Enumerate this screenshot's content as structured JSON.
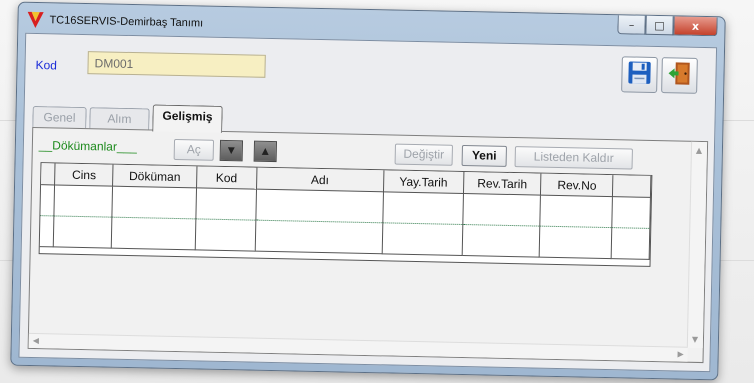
{
  "window": {
    "title": "TC16SERVIS-Demirbaş Tanımı",
    "caption_buttons": {
      "minimize": "–",
      "maximize": "□",
      "close": "x"
    }
  },
  "header": {
    "kod_label": "Kod",
    "kod_value": "DM001"
  },
  "tabs": [
    {
      "label": "Genel",
      "active": false
    },
    {
      "label": "Alım",
      "active": false
    },
    {
      "label": "Gelişmiş",
      "active": true
    }
  ],
  "documents": {
    "section_label": "__Dökümanlar___",
    "open_button": "Aç",
    "change_button": "Değiştir",
    "new_button": "Yeni",
    "remove_button": "Listeden Kaldır"
  },
  "grid": {
    "columns": [
      "Cins",
      "Döküman",
      "Kod",
      "Adı",
      "Yay.Tarih",
      "Rev.Tarih",
      "Rev.No"
    ]
  },
  "icons": {
    "app": "app-logo-icon",
    "save": "floppy-disk-icon",
    "exit": "exit-door-icon",
    "down": "arrow-down-icon",
    "up": "arrow-up-icon"
  },
  "colors": {
    "kod_label": "#1a2bd8",
    "doc_label": "#1c8a1c",
    "kod_input_bg": "#f7efc2",
    "close_button": "#c4412b"
  }
}
